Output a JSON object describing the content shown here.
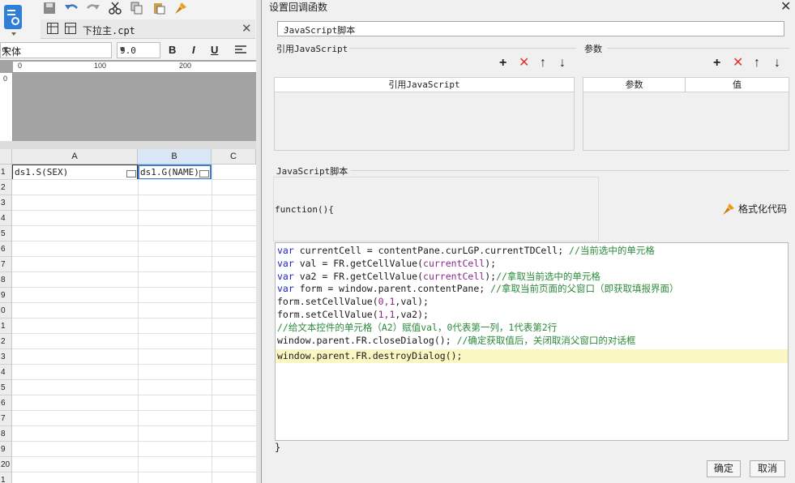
{
  "designer": {
    "doc_tab": "下拉主.cpt",
    "font_name": "宋体",
    "font_size": "9.0",
    "bold": "B",
    "italic": "I",
    "underline": "U",
    "ruler_marks": [
      "0",
      "100",
      "200"
    ],
    "ruler_side": "0",
    "columns": [
      "A",
      "B",
      "C"
    ],
    "rows": [
      "1",
      "2",
      "3",
      "4",
      "5",
      "6",
      "7",
      "8",
      "9",
      "0",
      "1",
      "2",
      "3",
      "4",
      "5",
      "6",
      "7",
      "8",
      "9",
      "20",
      "1"
    ],
    "cell_a1": "ds1.S(SEX)",
    "cell_b1": "ds1.G(NAME)"
  },
  "dialog": {
    "title": "设置回调函数",
    "type_selected": "JavaScript脚本",
    "left_section": "引用JavaScript",
    "right_section": "参数",
    "left_table_header": "引用JavaScript",
    "param_col": "参数",
    "value_col": "值",
    "script_section": "JavaScript脚本",
    "func_header": "function(){",
    "format_label": "格式化代码",
    "closing_brace": "}",
    "ok_label": "确定",
    "cancel_label": "取消",
    "code": {
      "l1_kw": "var",
      "l1_rest": " currentCell = contentPane.curLGP.currentTDCell; ",
      "l1_cm": "//当前选中的单元格",
      "l2_kw": "var",
      "l2_a": " val = FR.getCellValue(",
      "l2_st": "currentCell",
      "l2_b": ");",
      "l3_kw": "var",
      "l3_a": " va2 = FR.getCellValue(",
      "l3_st": "currentCell",
      "l3_b": ");",
      "l3_cm": "//拿取当前选中的单元格",
      "l4_kw": "var",
      "l4_rest": " form = window.parent.contentPane; ",
      "l4_cm": "//拿取当前页面的父窗口（即获取填报界面）",
      "l5": "form.setCellValue(",
      "l5_st": "0,1",
      "l5_b": ",val);",
      "l6": "form.setCellValue(",
      "l6_st": "1,1",
      "l6_b": ",va2);",
      "l7_cm": "//给文本控件的单元格（A2）赋值val，0代表第一列，1代表第2行",
      "l8": "window.parent.FR.closeDialog(); ",
      "l8_cm": "//确定获取值后，关闭取消父窗口的对话框",
      "l9": "window.parent.FR.destroyDialog();"
    }
  }
}
